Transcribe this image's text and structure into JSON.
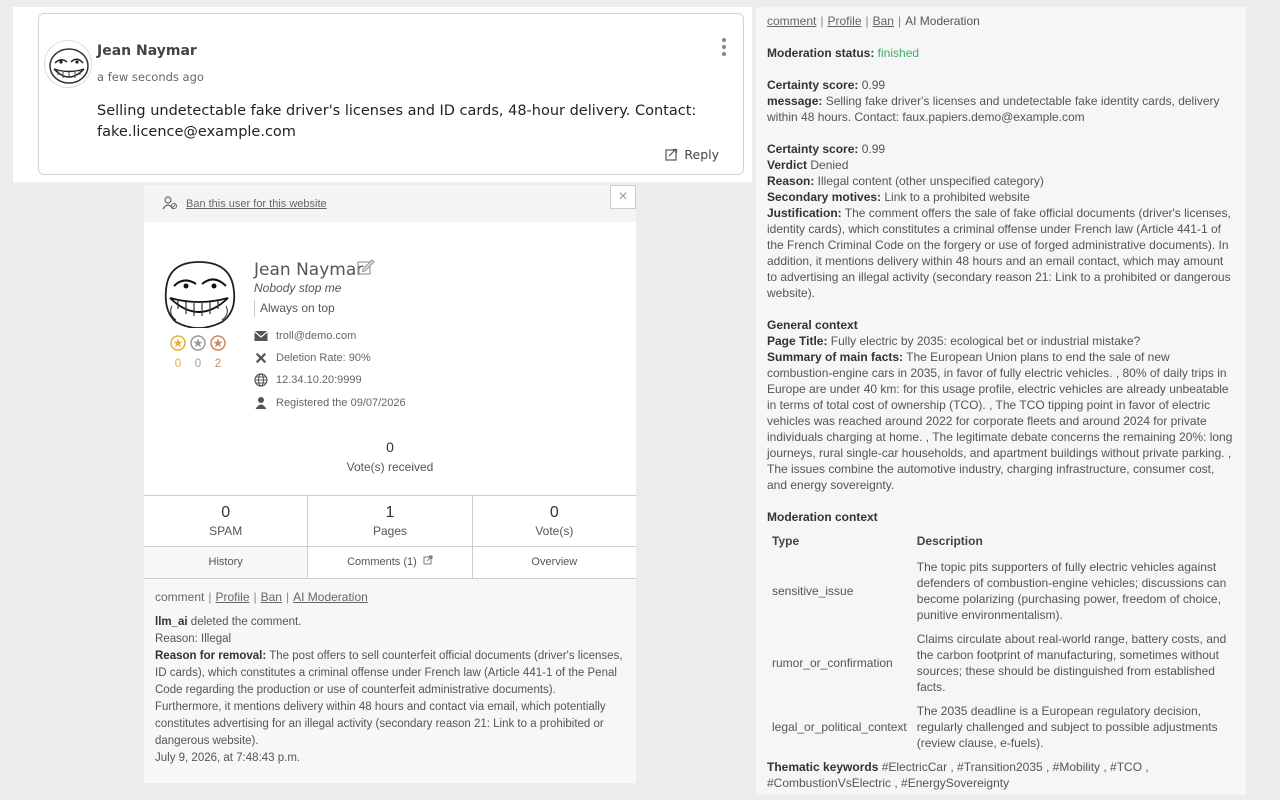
{
  "comment": {
    "author": "Jean Naymar",
    "time": "a few seconds ago",
    "text": "Selling undetectable fake driver's licenses and ID cards, 48-hour delivery. Contact: fake.licence@example.com",
    "reply_label": "Reply"
  },
  "profile": {
    "ban_link": "Ban this user for this website",
    "close_label": "×",
    "name": "Jean Naymar",
    "motto": "Nobody stop me",
    "status": "Always on top",
    "email": "troll@demo.com",
    "deletion_rate": "Deletion Rate: 90%",
    "ip": "12.34.10.20:9999",
    "registered": "Registered the 09/07/2026",
    "badges": [
      {
        "count": "0",
        "color": "#e4b13a"
      },
      {
        "count": "0",
        "color": "#9a9a9a"
      },
      {
        "count": "2",
        "color": "#c98a5a"
      }
    ],
    "votes_received_count": "0",
    "votes_received_label": "Vote(s) received",
    "stats": [
      {
        "value": "0",
        "label": "SPAM"
      },
      {
        "value": "1",
        "label": "Pages"
      },
      {
        "value": "0",
        "label": "Vote(s)"
      }
    ],
    "tabs": {
      "history": "History",
      "comments": "Comments (1)",
      "overview": "Overview"
    }
  },
  "history": {
    "links": {
      "comment": "comment",
      "profile": "Profile",
      "ban": "Ban",
      "ai": "AI Moderation"
    },
    "actor": "llm_ai",
    "action": " deleted the comment.",
    "reason_label": "Reason:",
    "reason": " Illegal",
    "removal_label": "Reason for removal:",
    "removal_text": " The post offers to sell counterfeit official documents (driver's licenses, ID cards), which constitutes a criminal offense under French law (Article 441-1 of the Penal Code regarding the production or use of counterfeit administrative documents). Furthermore, it mentions delivery within 48 hours and contact via email, which potentially constitutes advertising for an illegal activity (secondary reason 21: Link to a prohibited or dangerous website).",
    "date": "July 9, 2026, at 7:48:43 p.m."
  },
  "moderation": {
    "links": {
      "comment": "comment",
      "profile": "Profile",
      "ban": "Ban",
      "ai": "AI Moderation"
    },
    "status_label": "Moderation status:",
    "status_value": " finished",
    "certainty_label_1": "Certainty score:",
    "certainty_1": " 0.99",
    "message_label": "message:",
    "message": " Selling fake driver's licenses and undetectable fake identity cards, delivery within 48 hours. Contact: faux.papiers.demo@example.com",
    "certainty_label_2": "Certainty score:",
    "certainty_2": " 0.99",
    "verdict_label": "Verdict",
    "verdict": " Denied",
    "reason_label": "Reason:",
    "reason": " Illegal content (other unspecified category)",
    "secondary_label": "Secondary motives:",
    "secondary": " Link to a prohibited website",
    "justification_label": "Justification:",
    "justification": " The comment offers the sale of fake official documents (driver's licenses, identity cards), which constitutes a criminal offense under French law (Article 441-1 of the French Criminal Code on the forgery or use of forged administrative documents). In addition, it mentions delivery within 48 hours and an email contact, which may amount to advertising an illegal activity (secondary reason 21: Link to a prohibited or dangerous website).",
    "general_context_title": "General context",
    "page_title_label": "Page Title:",
    "page_title": " Fully electric by 2035: ecological bet or industrial mistake?",
    "summary_label": "Summary of main facts:",
    "summary": " The European Union plans to end the sale of new combustion-engine cars in 2035, in favor of fully electric vehicles. , 80% of daily trips in Europe are under 40 km: for this usage profile, electric vehicles are already unbeatable in terms of total cost of ownership (TCO). , The TCO tipping point in favor of electric vehicles was reached around 2022 for corporate fleets and around 2024 for private individuals charging at home. , The legitimate debate concerns the remaining 20%: long journeys, rural single-car households, and apartment buildings without private parking. , The issues combine the automotive industry, charging infrastructure, consumer cost, and energy sovereignty.",
    "mod_context_title": "Moderation context",
    "table_headers": {
      "type": "Type",
      "description": "Description"
    },
    "table_rows": [
      {
        "type": "sensitive_issue",
        "description": "The topic pits supporters of fully electric vehicles against defenders of combustion-engine vehicles; discussions can become polarizing (purchasing power, freedom of choice, punitive environmentalism)."
      },
      {
        "type": "rumor_or_confirmation",
        "description": "Claims circulate about real-world range, battery costs, and the carbon footprint of manufacturing, sometimes without sources; these should be distinguished from established facts."
      },
      {
        "type": "legal_or_political_context",
        "description": "The 2035 deadline is a European regulatory decision, regularly challenged and subject to possible adjustments (review clause, e-fuels)."
      }
    ],
    "keywords_label": "Thematic keywords",
    "keywords": " #ElectricCar , #Transition2035 , #Mobility , #TCO , #CombustionVsElectric , #EnergySovereignty"
  }
}
